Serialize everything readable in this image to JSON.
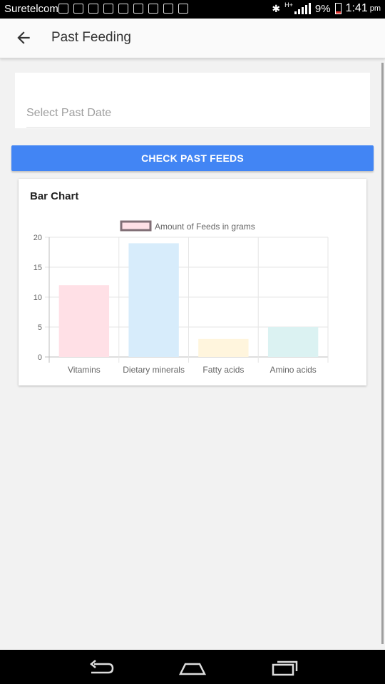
{
  "status_bar": {
    "carrier": "Suretelcom",
    "network": "H+",
    "battery": "9%",
    "time": "1:41",
    "ampm": "pm"
  },
  "app_bar": {
    "title": "Past Feeding"
  },
  "date_picker": {
    "placeholder": "Select Past Date",
    "value": ""
  },
  "check_button": {
    "label": "CHECK PAST FEEDS"
  },
  "chart_card": {
    "title": "Bar Chart"
  },
  "chart_data": {
    "type": "bar",
    "title": "",
    "xlabel": "",
    "ylabel": "",
    "categories": [
      "Vitamins",
      "Dietary minerals",
      "Fatty acids",
      "Amino acids"
    ],
    "series": [
      {
        "name": "Amount of Feeds in grams",
        "values": [
          12,
          19,
          3,
          5
        ]
      }
    ],
    "bar_colors": [
      "#ffe0e6",
      "#d7ecfb",
      "#fff5dd",
      "#dbf2f2"
    ],
    "legend_swatch_color": "#ffe0e6",
    "legend_border_color": "#806e75",
    "ylim": [
      0,
      20
    ],
    "yticks": [
      "0",
      "5",
      "10",
      "15",
      "20"
    ],
    "grid": true,
    "legend_position": "top"
  }
}
